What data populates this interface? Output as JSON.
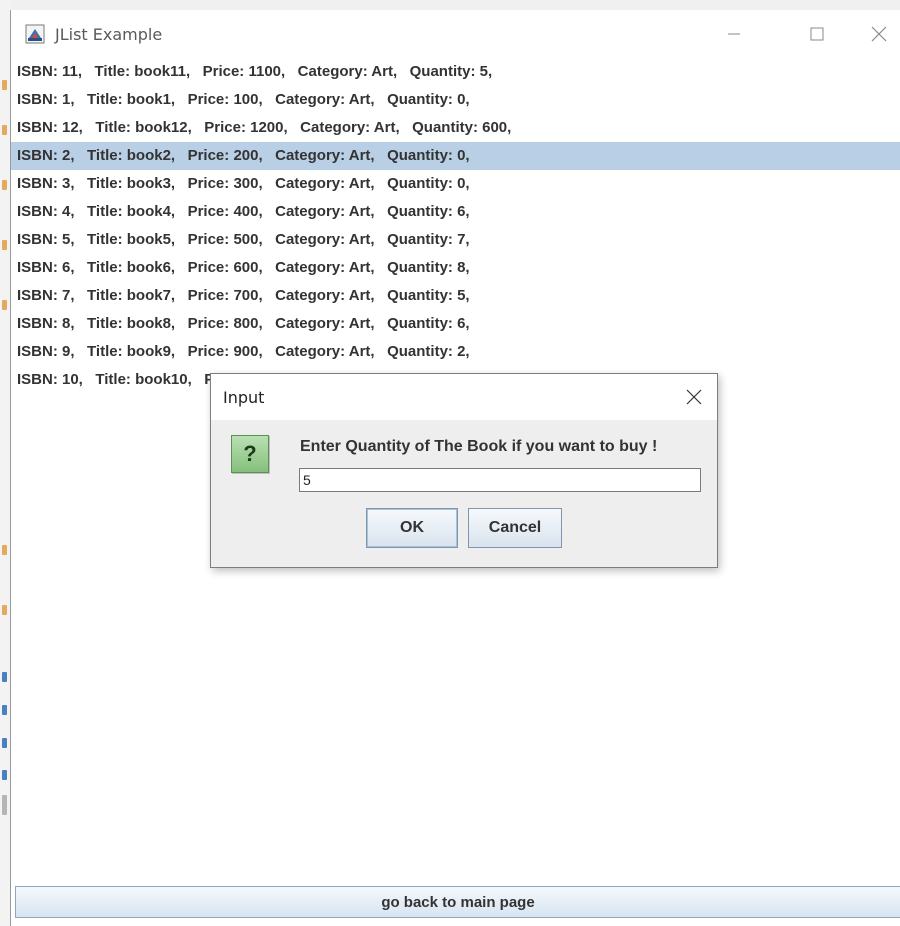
{
  "colors": {
    "selection": "#b8cfe5",
    "question_icon": "#86c07d"
  },
  "window": {
    "title": "JList Example",
    "app_icon": "java-cup-icon",
    "controls": [
      "minimize-icon",
      "maximize-icon",
      "close-icon"
    ]
  },
  "list": {
    "selected_index": 3,
    "items": [
      "ISBN: 11,   Title: book11,   Price: 1100,   Category: Art,   Quantity: 5,",
      "ISBN: 1,   Title: book1,   Price: 100,   Category: Art,   Quantity: 0,",
      "ISBN: 12,   Title: book12,   Price: 1200,   Category: Art,   Quantity: 600,",
      "ISBN: 2,   Title: book2,   Price: 200,   Category: Art,   Quantity: 0,",
      "ISBN: 3,   Title: book3,   Price: 300,   Category: Art,   Quantity: 0,",
      "ISBN: 4,   Title: book4,   Price: 400,   Category: Art,   Quantity: 6,",
      "ISBN: 5,   Title: book5,   Price: 500,   Category: Art,   Quantity: 7,",
      "ISBN: 6,   Title: book6,   Price: 600,   Category: Art,   Quantity: 8,",
      "ISBN: 7,   Title: book7,   Price: 700,   Category: Art,   Quantity: 5,",
      "ISBN: 8,   Title: book8,   Price: 800,   Category: Art,   Quantity: 6,",
      "ISBN: 9,   Title: book9,   Price: 900,   Category: Art,   Quantity: 2,",
      "ISBN: 10,   Title: book10,   Price: 1000,   Category: Art,   Quantity: 1,"
    ]
  },
  "bottom_button": {
    "label": "go back to main page"
  },
  "dialog": {
    "title": "Input",
    "icon": "question-icon",
    "icon_glyph": "?",
    "message": "Enter Quantity of The Book if you want to buy !",
    "input_value": "5",
    "ok_label": "OK",
    "cancel_label": "Cancel"
  }
}
